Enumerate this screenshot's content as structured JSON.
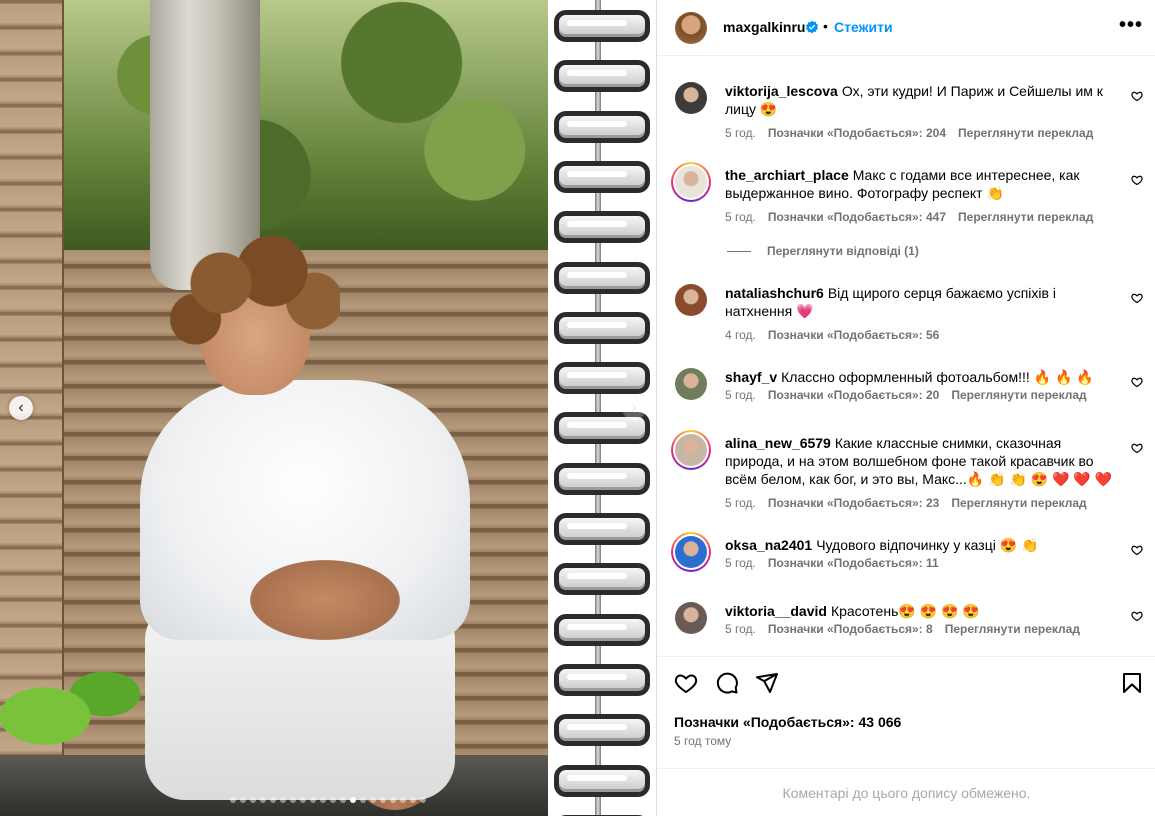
{
  "post": {
    "username": "maxgalkinru",
    "follow_label": "Стежити",
    "dot": "•",
    "more_label": "•••"
  },
  "photo": {
    "slide_count": 20,
    "active_slide": 12,
    "prev_label": "‹",
    "next_label": "›"
  },
  "comments": [
    {
      "user": "viktorija_lescova",
      "text": "Ох, эти кудри! И Париж и Сейшелы им к лицу 😍",
      "time": "5 год.",
      "likes": "Позначки «Подобається»: 204",
      "translate": "Переглянути переклад",
      "avatar_color": "#3b3b3b",
      "story_ring": false
    },
    {
      "user": "the_archiart_place",
      "text": "Макс с годами все интереснее, как выдержанное вино. Фотографу респект 👏",
      "time": "5 год.",
      "likes": "Позначки «Подобається»: 447",
      "translate": "Переглянути переклад",
      "avatar_color": "#e9e4da",
      "story_ring": true
    },
    {
      "user": "nataliashchur6",
      "text": "Від щирого серця бажаємо успіхів і натхнення 💗",
      "time": "4 год.",
      "likes": "Позначки «Подобається»: 56",
      "translate": "",
      "avatar_color": "#8a4b2d",
      "story_ring": false
    },
    {
      "user": "shayf_v",
      "text": "Классно оформленный фотоальбом!!! 🔥 🔥 🔥",
      "time": "5 год.",
      "likes": "Позначки «Подобається»: 20",
      "translate": "Переглянути переклад",
      "avatar_color": "#6f7d5a",
      "story_ring": false
    },
    {
      "user": "alina_new_6579",
      "text": "Какие классные снимки, сказочная природа, и на этом волшебном фоне такой красавчик во всём белом, как бог, и это вы, Макс...🔥 👏 👏 😍 ❤️ ❤️ ❤️",
      "time": "5 год.",
      "likes": "Позначки «Подобається»: 23",
      "translate": "Переглянути переклад",
      "avatar_color": "#c8b6a4",
      "story_ring": true
    },
    {
      "user": "oksa_na2401",
      "text": "Чудового відпочинку у казці 😍 👏",
      "time": "5 год.",
      "likes": "Позначки «Подобається»: 11",
      "translate": "",
      "avatar_color": "#2d6fd1",
      "story_ring": true
    },
    {
      "user": "viktoria__david",
      "text": "Красотень😍 😍 😍 😍",
      "time": "5 год.",
      "likes": "Позначки «Подобається»: 8",
      "translate": "Переглянути переклад",
      "avatar_color": "#6a5a55",
      "story_ring": false
    }
  ],
  "view_replies": "Переглянути відповіді (1)",
  "footer": {
    "likes_total": "Позначки «Подобається»: 43 066",
    "posted": "5 год тому",
    "comments_limited": "Коментарі до цього допису обмежено."
  },
  "icons": {
    "like": "heart-icon",
    "comment": "comment-icon",
    "share": "share-icon",
    "save": "bookmark-icon",
    "verified": "verified-badge-icon",
    "more": "more-options-icon"
  },
  "colors": {
    "accent": "#0095f6",
    "muted": "#737373",
    "disabled": "#a8a8a8",
    "border": "#dbdbdb"
  }
}
